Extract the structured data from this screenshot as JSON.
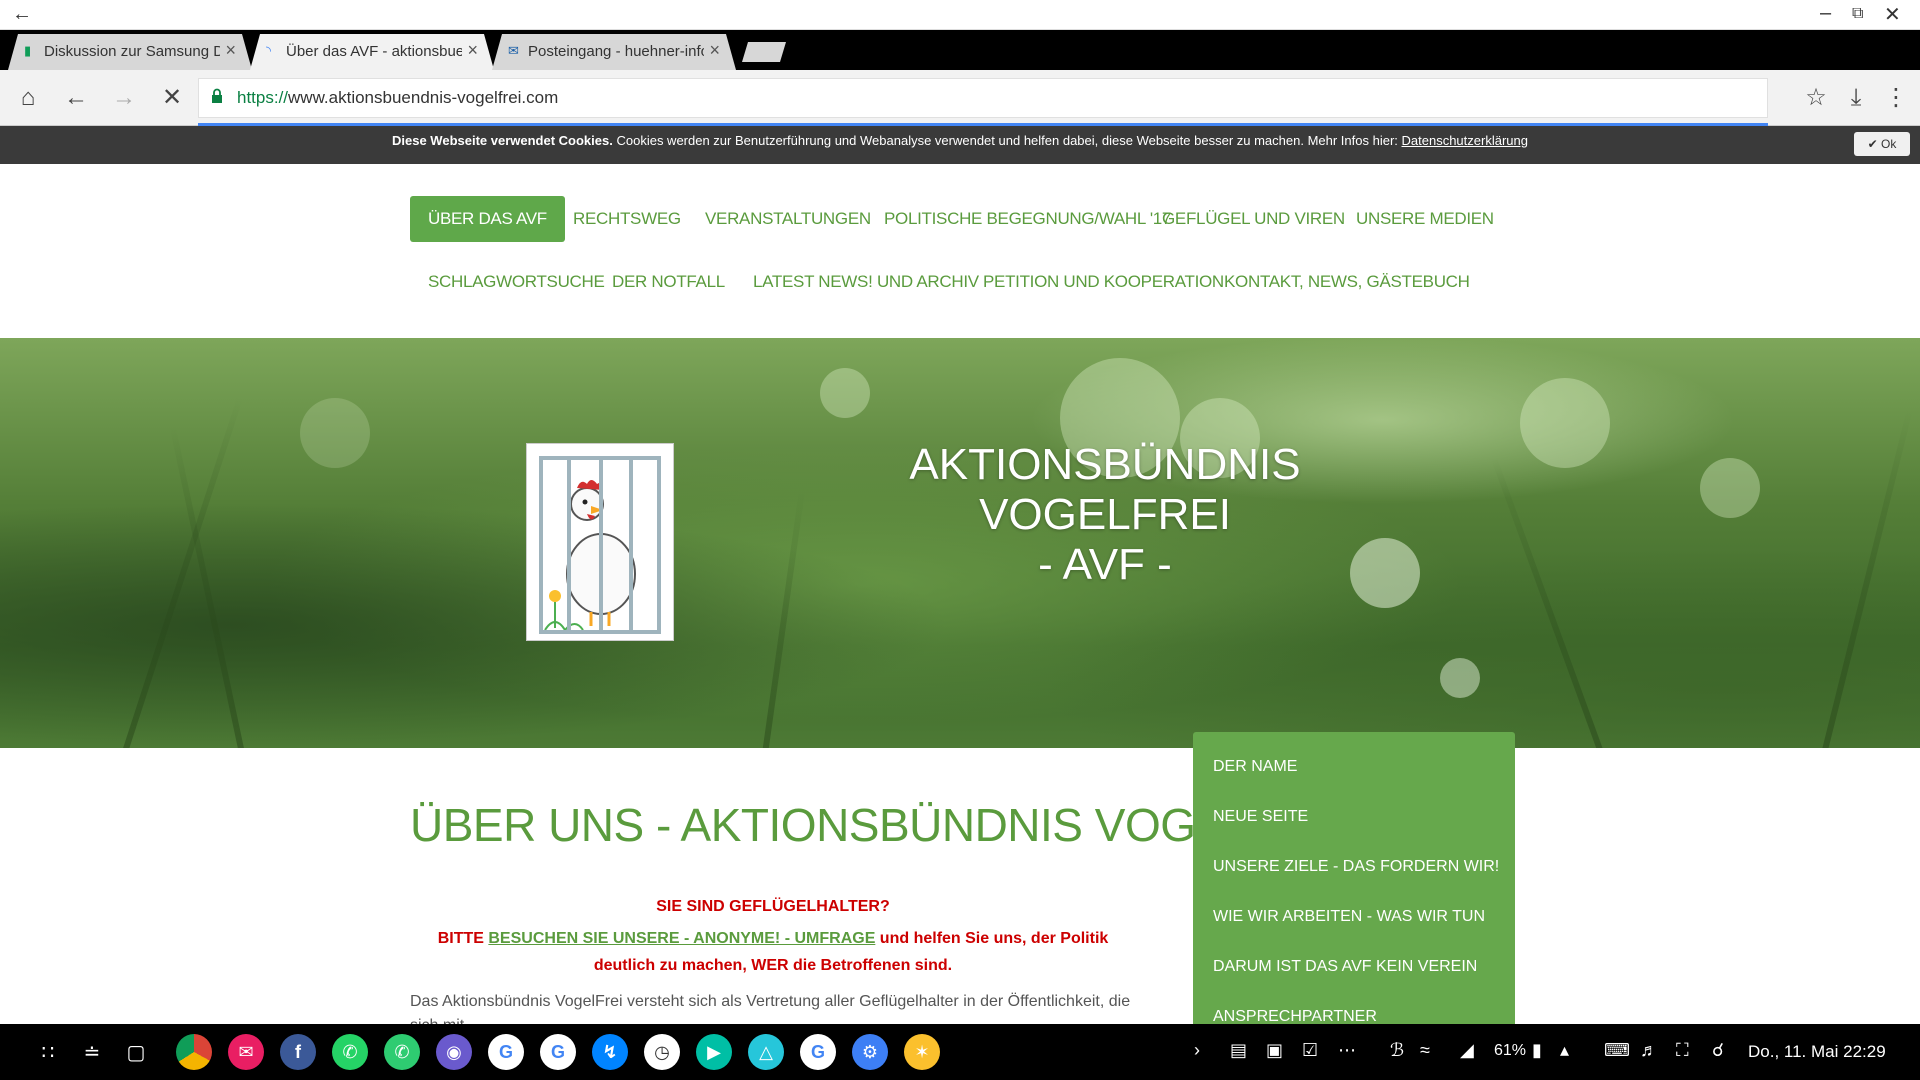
{
  "browser": {
    "tabs": [
      {
        "title": "Diskussion zur Samsung DeX",
        "icon": "doc-icon",
        "active": false
      },
      {
        "title": "Über das AVF - aktionsbuendnis",
        "icon": "loading-icon",
        "active": true
      },
      {
        "title": "Posteingang - huehner-info.de",
        "icon": "mail-icon",
        "active": false
      }
    ],
    "url_scheme": "https://",
    "url_rest": "www.aktionsbuendnis-vogelfrei.com"
  },
  "cookie": {
    "bold": "Diese Webseite verwendet Cookies.",
    "text": " Cookies werden zur Benutzerführung und Webanalyse verwendet und helfen dabei, diese Webseite besser zu machen. Mehr Infos hier: ",
    "link": "Datenschutzerklärung",
    "ok": "Ok",
    "ok_check": "✔"
  },
  "nav": {
    "row1": [
      "Über das AVF",
      "Rechtsweg",
      "Veranstaltungen",
      "Politische Begegnung/Wahl '17",
      "Geflügel und Viren",
      "Unsere Medien"
    ],
    "row2": [
      "Schlagwortsuche",
      "Der Notfall",
      "Latest News! und Archiv",
      "Petition und Kooperation",
      "Kontakt, News, Gästebuch"
    ]
  },
  "hero": {
    "title_line1": "AKTIONSBÜNDNIS VOGELFREI",
    "title_line2": "- AVF -"
  },
  "main": {
    "title": "ÜBER UNS - AKTIONSBÜNDNIS VOGELFREI",
    "q1": "SIE SIND GEFLÜGELHALTER?",
    "q2_pre": "BITTE ",
    "q2_link": "BESUCHEN SIE UNSERE - ANONYME! - UMFRAGE",
    "q2_post": " und helfen Sie uns, der Politik deutlich zu machen, WER die Betroffenen sind.",
    "body": "Das Aktionsbündnis VogelFrei versteht sich als Vertretung aller Geflügelhalter in der Öffentlichkeit, die sich mit"
  },
  "sidebar": {
    "items": [
      "Der Name",
      "Neue Seite",
      "Unsere Ziele - das fordern wir!",
      "Wie wir arbeiten - was wir tun",
      "Darum ist das AVF kein Verein",
      "Ansprechpartner"
    ]
  },
  "taskbar": {
    "battery": "61%",
    "clock": "Do., 11. Mai 22:29"
  },
  "colors": {
    "brand_green": "#5fa84a",
    "alert_red": "#cc0000"
  }
}
